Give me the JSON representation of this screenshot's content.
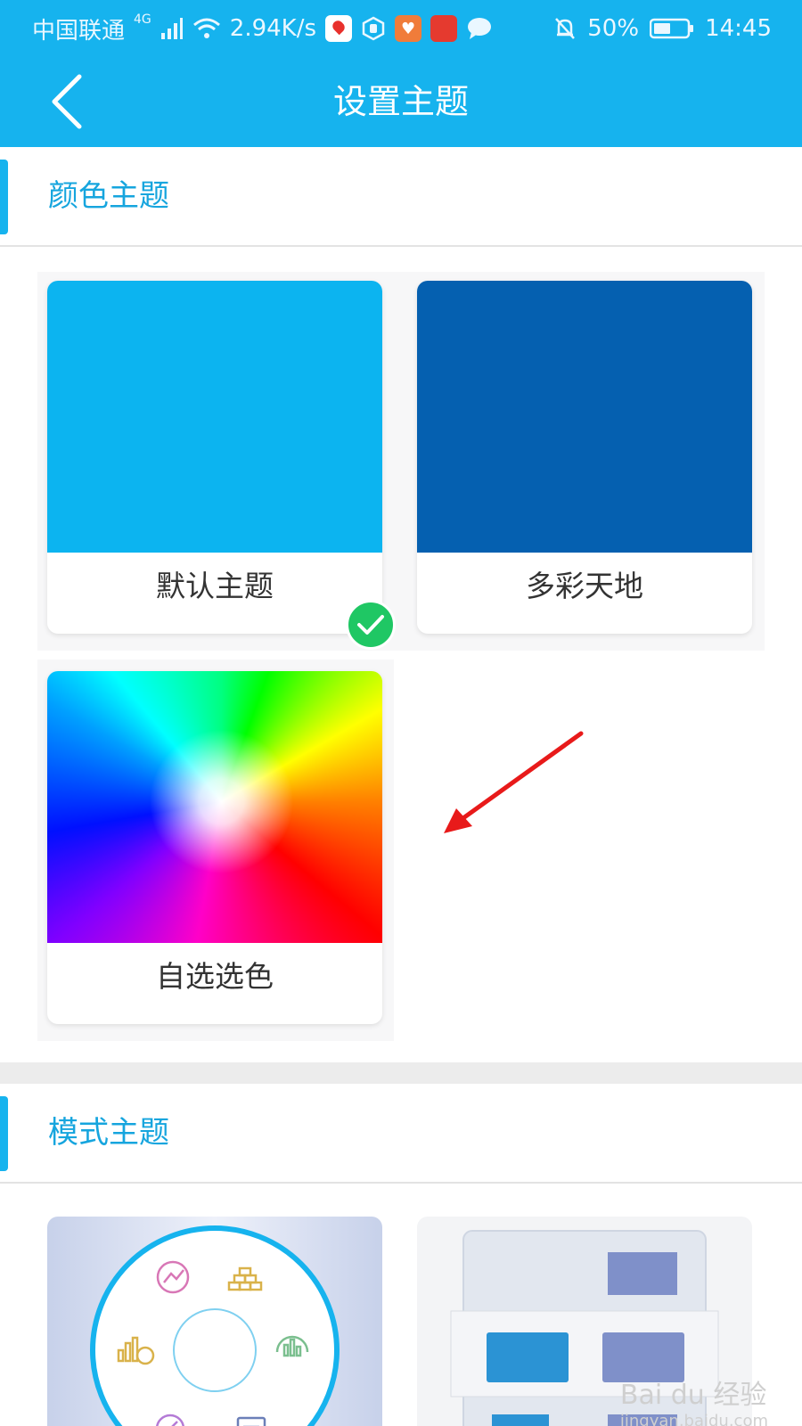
{
  "status_bar": {
    "carrier": "中国联通",
    "network": "4G",
    "speed": "2.94K/s",
    "battery": "50%",
    "time": "14:45"
  },
  "header": {
    "title": "设置主题",
    "accent_color": "#16b3ee"
  },
  "color_theme_section": {
    "title": "颜色主题",
    "items": [
      {
        "label": "默认主题",
        "color": "#0cb4f0",
        "selected": true
      },
      {
        "label": "多彩天地",
        "color": "#0560b0",
        "selected": false
      },
      {
        "label": "自选选色",
        "color": "rainbow",
        "selected": false
      }
    ]
  },
  "mode_theme_section": {
    "title": "模式主题",
    "items": [
      {
        "preview": "circular-menu-layout"
      },
      {
        "preview": "grid-tiles-layout"
      }
    ]
  },
  "watermark": {
    "brand": "Bai du 经验",
    "url": "jingyan.baidu.com"
  }
}
